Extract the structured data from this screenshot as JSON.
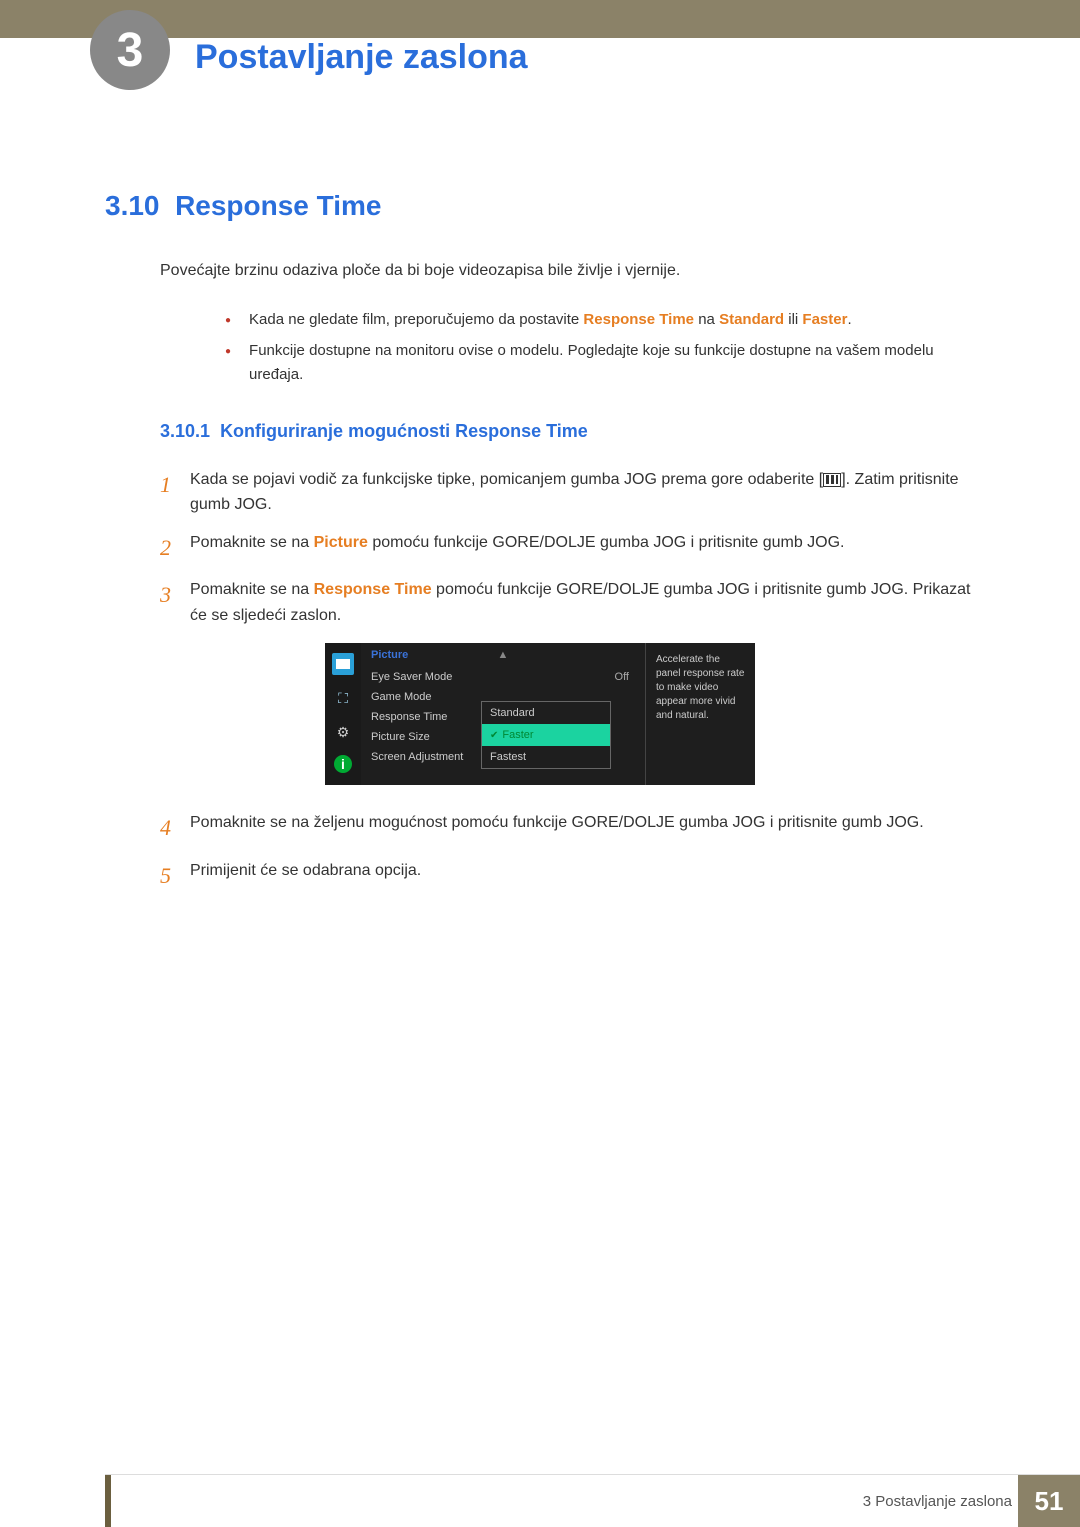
{
  "chapter": {
    "number": "3",
    "title": "Postavljanje zaslona"
  },
  "section": {
    "number": "3.10",
    "title": "Response Time"
  },
  "intro": "Povećajte brzinu odaziva ploče da bi boje videozapisa bile življe i vjernije.",
  "notes": [
    {
      "pre": "Kada ne gledate film, preporučujemo da postavite ",
      "em1": "Response Time",
      "mid": " na ",
      "em2": "Standard",
      "or": " ili ",
      "em3": "Faster",
      "post": "."
    },
    {
      "plain": "Funkcije dostupne na monitoru ovise o modelu. Pogledajte koje su funkcije dostupne na vašem modelu uređaja."
    }
  ],
  "subsection": {
    "number": "3.10.1",
    "title": "Konfiguriranje mogućnosti Response Time"
  },
  "steps": {
    "s1a": "Kada se pojavi vodič za funkcijske tipke, pomicanjem gumba JOG prema gore odaberite [",
    "s1b": "]. Zatim pritisnite gumb JOG.",
    "s2a": "Pomaknite se na ",
    "s2_em": "Picture",
    "s2b": " pomoću funkcije GORE/DOLJE gumba JOG i pritisnite gumb JOG.",
    "s3a": "Pomaknite se na ",
    "s3_em": "Response Time",
    "s3b": " pomoću funkcije GORE/DOLJE gumba JOG i pritisnite gumb JOG. Prikazat će se sljedeći zaslon.",
    "s4": "Pomaknite se na željenu mogućnost pomoću funkcije GORE/DOLJE gumba JOG i pritisnite gumb JOG.",
    "s5": "Primijenit će se odabrana opcija."
  },
  "osd": {
    "title": "Picture",
    "rows": [
      {
        "label": "Eye Saver Mode",
        "value": "Off"
      },
      {
        "label": "Game Mode",
        "value": ""
      },
      {
        "label": "Response Time",
        "value": ""
      },
      {
        "label": "Picture Size",
        "value": ""
      },
      {
        "label": "Screen Adjustment",
        "value": ""
      }
    ],
    "dropdown": [
      "Standard",
      "Faster",
      "Fastest"
    ],
    "selected": "Faster",
    "help": "Accelerate the panel response rate to make video appear more vivid and natural."
  },
  "footer": {
    "text": "3 Postavljanje zaslona",
    "page": "51"
  }
}
